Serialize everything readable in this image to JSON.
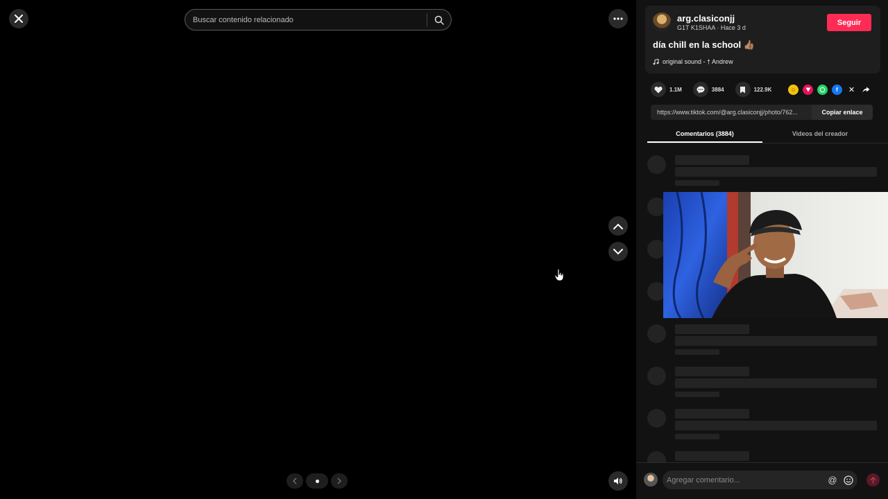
{
  "viewer": {
    "search_placeholder": "Buscar contenido relacionado"
  },
  "post": {
    "username": "arg.clasiconjj",
    "meta": "G1T K1SHAA · Hace 3 d",
    "follow_label": "Seguir",
    "caption": "día chill en la school 👍🏽",
    "sound": "original sound - † Andrew"
  },
  "stats": {
    "likes": "1.1M",
    "comments": "3884",
    "saves": "122.9K"
  },
  "share": {
    "link": "https://www.tiktok.com/@arg.clasiconjj/photo/762...",
    "copy_label": "Copiar enlace"
  },
  "tabs": [
    {
      "label": "Comentarios (3884)",
      "active": true
    },
    {
      "label": "Videos del creador",
      "active": false
    }
  ],
  "composer": {
    "placeholder": "Agregar comentario..."
  },
  "colors": {
    "accent": "#fe2c55",
    "panel_bg": "#121212",
    "card_bg": "#1e1e1e"
  }
}
